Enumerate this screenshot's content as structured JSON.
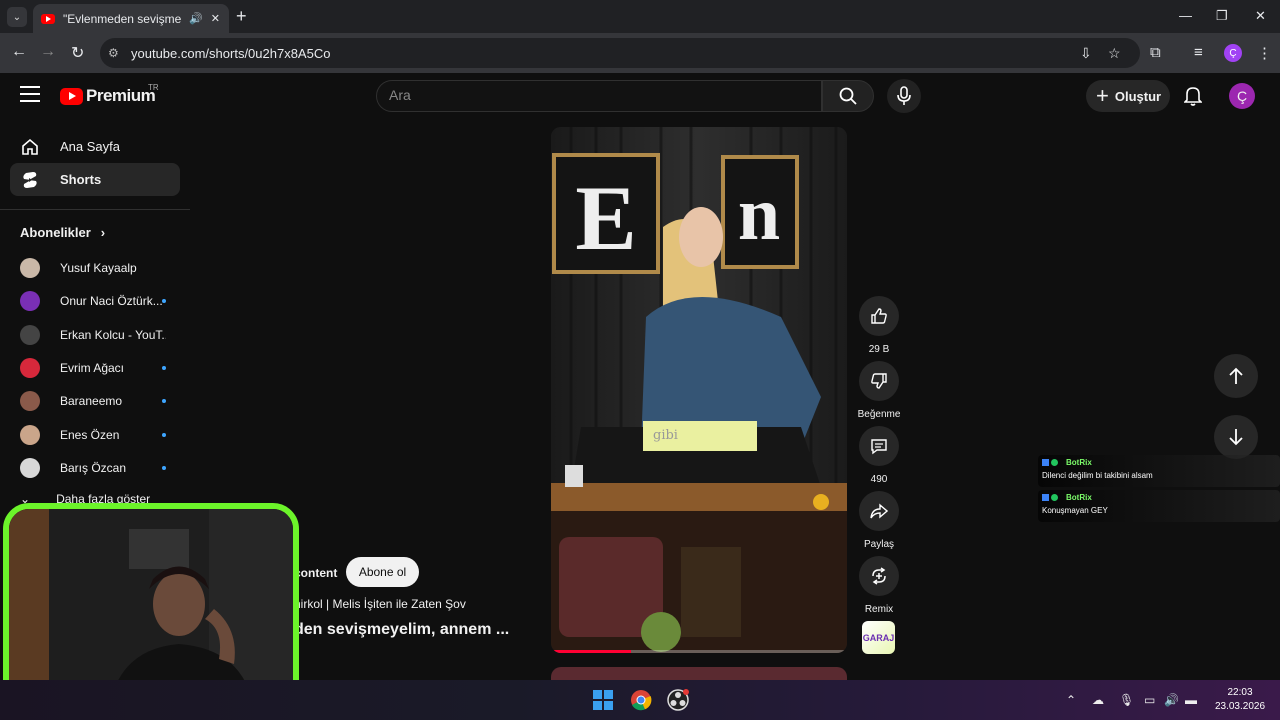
{
  "browser": {
    "tab_title": "\"Evlenmeden sevişmeyelim,",
    "url": "youtube.com/shorts/0u2h7x8A5Co",
    "new_tab": "+",
    "profile_initial": "Ç"
  },
  "masthead": {
    "logo_text": "Premium",
    "logo_country": "TR",
    "search_placeholder": "Ara",
    "create_label": "Oluştur",
    "avatar_initial": "Ç"
  },
  "sidebar": {
    "nav": [
      {
        "label": "Ana Sayfa",
        "icon": "home-icon"
      },
      {
        "label": "Shorts",
        "icon": "shorts-icon"
      }
    ],
    "subscriptions_header": "Abonelikler",
    "subscriptions": [
      {
        "name": "Yusuf Kayaalp",
        "color": "#c9b8a8",
        "new": false
      },
      {
        "name": "Onur Naci Öztürk...",
        "color": "#7a2fb5",
        "new": true
      },
      {
        "name": "Erkan Kolcu - YouT...",
        "color": "#444444",
        "new": false
      },
      {
        "name": "Evrim Ağacı",
        "color": "#d6283b",
        "new": true
      },
      {
        "name": "Baraneemo",
        "color": "#8a5a4a",
        "new": true
      },
      {
        "name": "Enes Özen",
        "color": "#caa58a",
        "new": true
      },
      {
        "name": "Barış Özcan",
        "color": "#d8d8d8",
        "new": true
      }
    ],
    "show_more": "Daha fazla göster"
  },
  "short": {
    "caption": "gibi",
    "progress": 0.27,
    "channel_name": "content",
    "subscribe_label": "Abone ol",
    "sound": "nirkol | Melis İşiten ile Zaten Şov",
    "title": "den sevişmeyelim, annem ..."
  },
  "actions": {
    "like_count": "29 B",
    "dislike_label": "Beğenme",
    "comment_count": "490",
    "share_label": "Paylaş",
    "remix_label": "Remix",
    "sound_thumb_text": "GARAJ"
  },
  "chat": [
    {
      "user": "BotRix",
      "text": "Dilenci değilim bi takibini alsam"
    },
    {
      "user": "BotRix",
      "text": "Konuşmayan GEY"
    }
  ],
  "taskbar": {
    "time": "22:03",
    "date": "23.03.2026"
  },
  "colors": {
    "accent": "#ff0000",
    "webcam_border": "#6cf42a",
    "avatar": "#9c27b0"
  }
}
